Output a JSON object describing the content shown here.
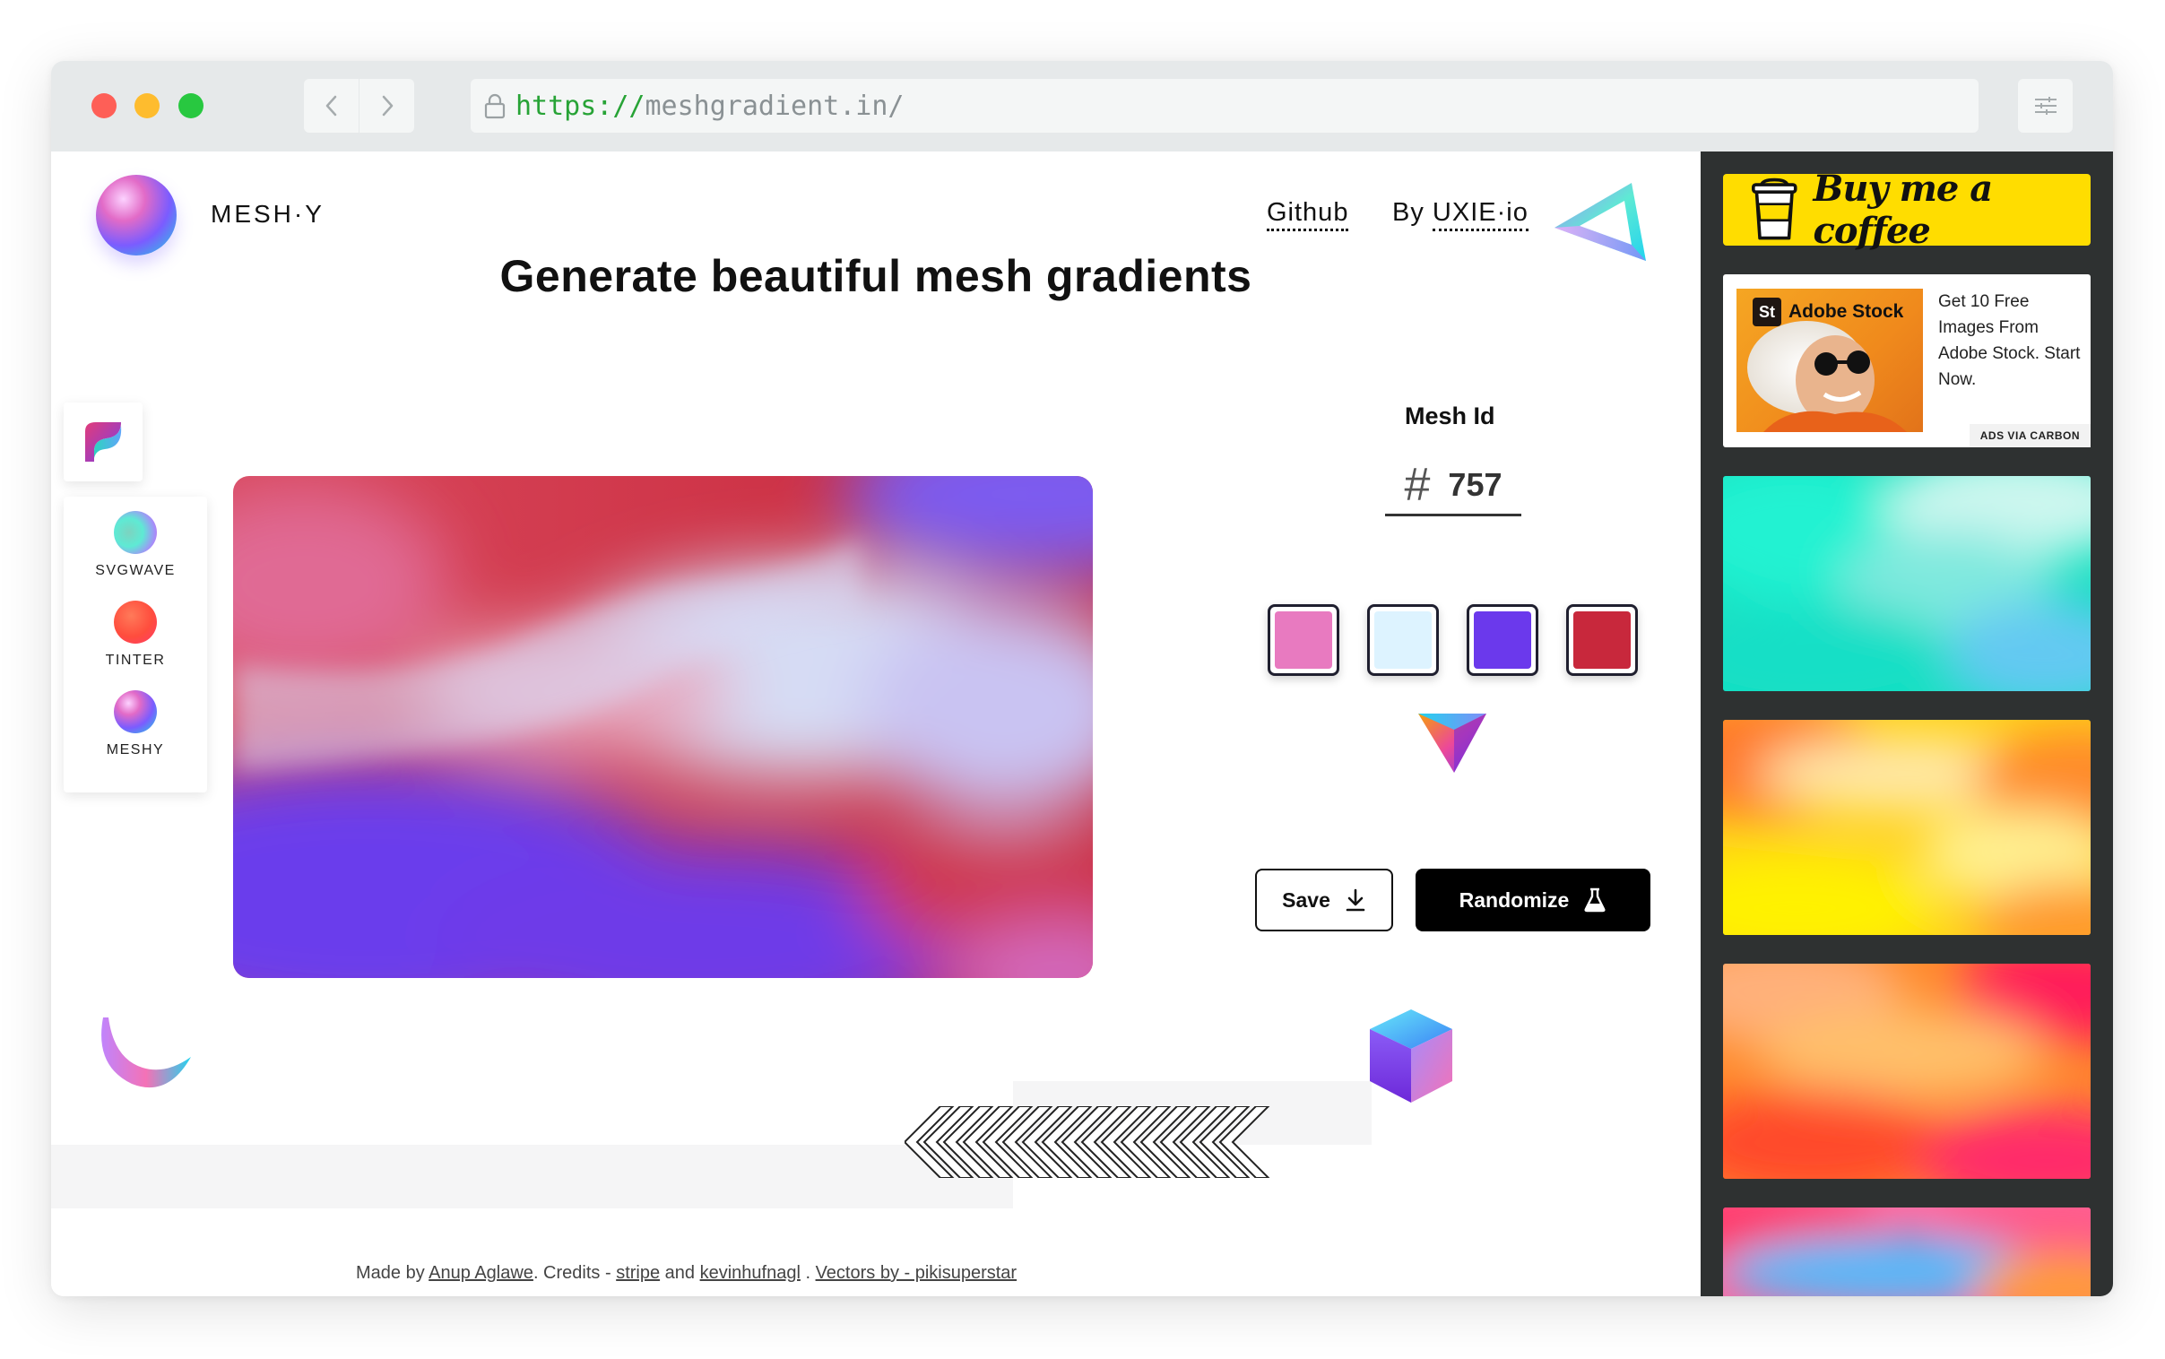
{
  "browser": {
    "url_scheme": "https://",
    "url_host": "meshgradient.in/"
  },
  "header": {
    "brand": "MESH·Y",
    "github_label": "Github",
    "by_prefix": "By",
    "by_link": "UXIE·io",
    "headline": "Generate beautiful mesh gradients"
  },
  "side_apps": [
    {
      "label": "SVGWAVE"
    },
    {
      "label": "TINTER"
    },
    {
      "label": "MESHY"
    }
  ],
  "mesh": {
    "id_label": "Mesh Id",
    "hash": "#",
    "id_value": "757",
    "colors": [
      "#e87ac0",
      "#ddf3ff",
      "#6b39ec",
      "#c8283c"
    ]
  },
  "actions": {
    "save_label": "Save",
    "randomize_label": "Randomize"
  },
  "footer": {
    "made_by": "Made by ",
    "author": "Anup Aglawe",
    "credits": ". Credits - ",
    "credit1": "stripe",
    "and": " and ",
    "credit2": "kevinhufnagl",
    "sep": " . ",
    "vectors": "Vectors by - pikisuperstar"
  },
  "sidebar": {
    "coffee_label": "Buy me a coffee",
    "ad_brand": "Adobe Stock",
    "ad_text": "Get 10 Free Images From Adobe Stock. Start Now.",
    "ad_via": "ADS VIA CARBON"
  },
  "icons": {
    "lock": "lock-icon",
    "back": "chevron-left-icon",
    "forward": "chevron-right-icon",
    "menu": "sliders-icon",
    "download": "download-icon",
    "flask": "flask-icon",
    "cup": "coffee-cup-icon"
  }
}
